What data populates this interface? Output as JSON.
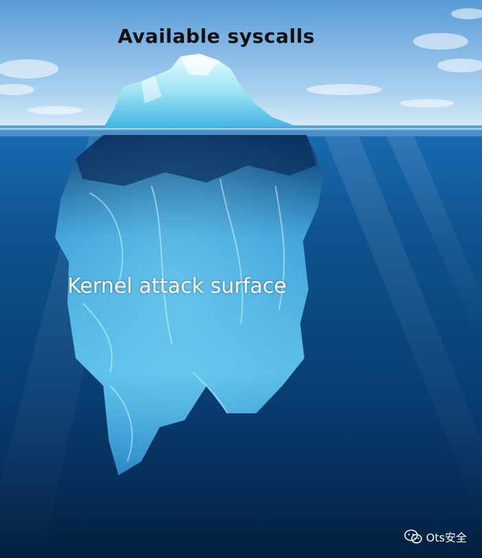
{
  "labels": {
    "top": "Available syscalls",
    "middle": "Kernel attack surface"
  },
  "watermark": {
    "icon": "wechat-icon",
    "text": "Ots安全"
  },
  "colors": {
    "sky_top": "#5e9fd8",
    "sky_horizon": "#d9ecf8",
    "ocean_deep": "#05264f",
    "ocean_mid": "#0d4f92",
    "ice_light": "#bdf3fb",
    "ice_mid": "#4fc0e8",
    "top_label": "#111111",
    "middle_label": "#ffffff"
  }
}
